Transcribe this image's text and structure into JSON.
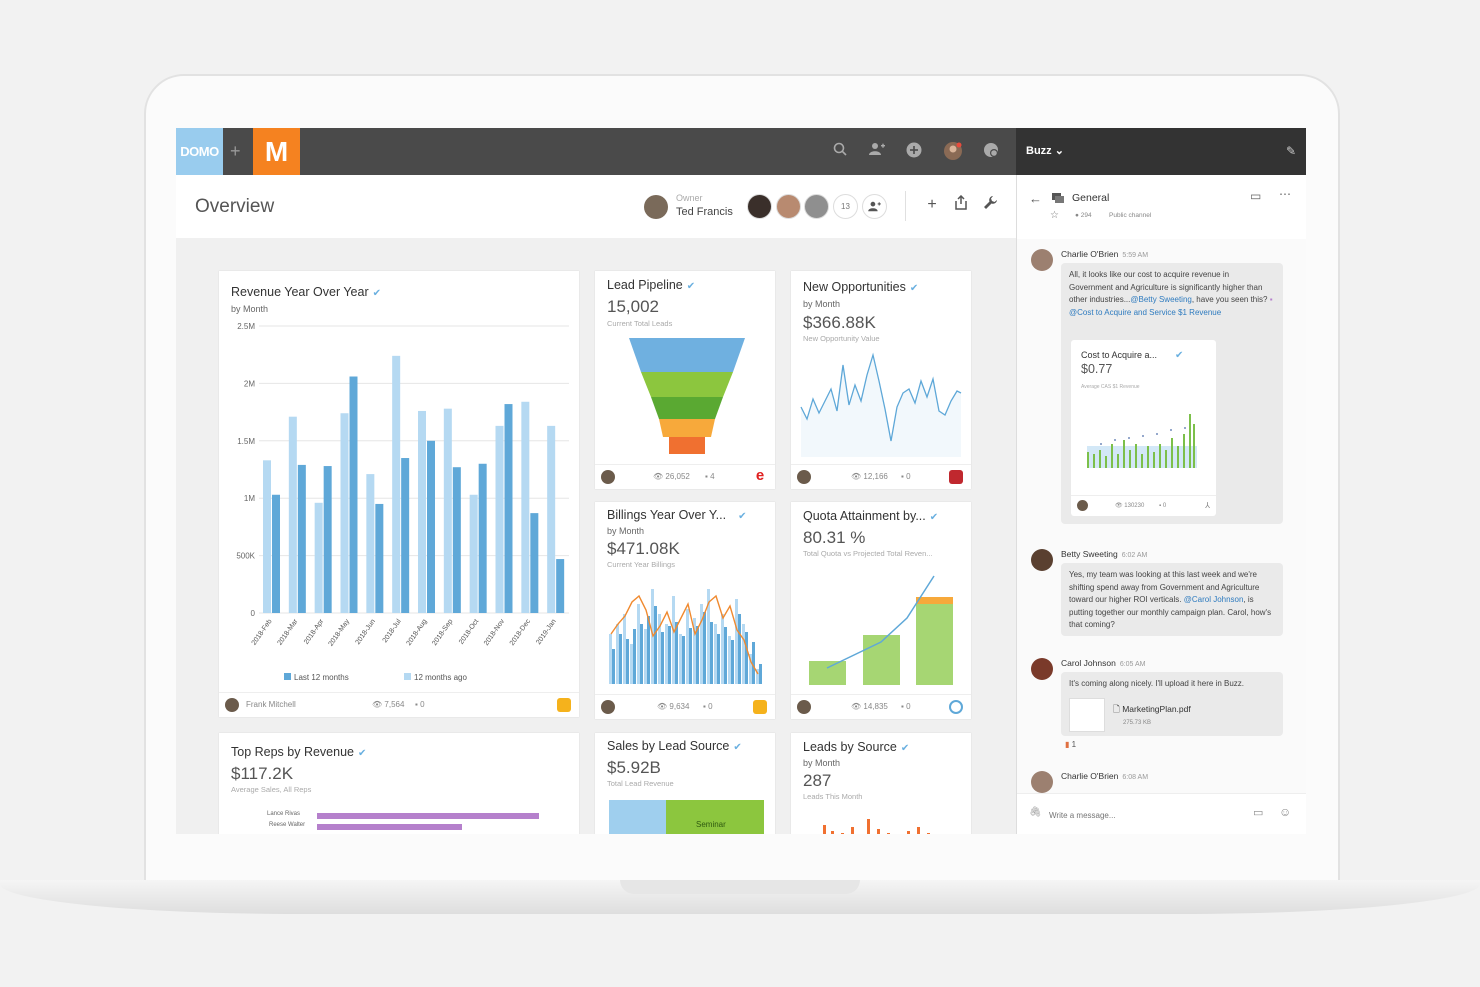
{
  "topbar": {
    "domo_logo": "DOMO",
    "plus": "+",
    "app_logo": "M",
    "icons": [
      "search-icon",
      "add-person-icon",
      "plus-circle-icon",
      "user-avatar",
      "buzz-icon"
    ]
  },
  "buzz_bar": {
    "title": "Buzz",
    "chevron": "⌄",
    "edit_icon": "✎"
  },
  "header": {
    "title": "Overview",
    "owner_label": "Owner",
    "owner_name": "Ted Francis",
    "member_count": "13"
  },
  "cards": {
    "revenue_yoy": {
      "title": "Revenue Year Over Year",
      "subtitle": "by Month",
      "legend_a": "Last 12 months",
      "legend_b": "12 months ago",
      "footer_name": "Frank Mitchell",
      "views": "7,564",
      "comments": "0"
    },
    "lead_pipeline": {
      "title": "Lead Pipeline",
      "value": "15,002",
      "caption": "Current Total Leads",
      "views": "26,052",
      "comments": "4"
    },
    "new_opps": {
      "title": "New Opportunities",
      "subtitle": "by Month",
      "value": "$366.88K",
      "caption": "New Opportunity Value",
      "views": "12,166",
      "comments": "0"
    },
    "billings": {
      "title": "Billings Year Over Y...",
      "subtitle": "by Month",
      "value": "$471.08K",
      "caption": "Current Year Billings",
      "views": "9,634",
      "comments": "0"
    },
    "quota": {
      "title": "Quota Attainment by...",
      "value": "80.31 %",
      "caption": "Total Quota vs Projected Total Reven...",
      "views": "14,835",
      "comments": "0"
    },
    "top_reps": {
      "title": "Top Reps by Revenue",
      "value": "$117.2K",
      "caption": "Average Sales, All Reps",
      "rep1": "Lance Rivas",
      "rep2": "Reese Walter"
    },
    "sales_source": {
      "title": "Sales by Lead Source",
      "value": "$5.92B",
      "caption": "Total Lead Revenue",
      "segment": "Seminar"
    },
    "leads_source": {
      "title": "Leads by Source",
      "subtitle": "by Month",
      "value": "287",
      "caption": "Leads This Month"
    }
  },
  "chart_data": [
    {
      "type": "bar",
      "title": "Revenue Year Over Year",
      "categories": [
        "2018-Feb",
        "2018-Mar",
        "2018-Apr",
        "2018-May",
        "2018-Jun",
        "2018-Jul",
        "2018-Aug",
        "2018-Sep",
        "2018-Oct",
        "2018-Nov",
        "2018-Dec",
        "2019-Jan"
      ],
      "ylim": [
        0,
        2500000
      ],
      "yticks": [
        "0",
        "500K",
        "1M",
        "1.5M",
        "2M",
        "2.5M"
      ],
      "series": [
        {
          "name": "Last 12 months",
          "values": [
            1030000,
            1290000,
            1280000,
            2060000,
            950000,
            1350000,
            1500000,
            1270000,
            1300000,
            1820000,
            870000,
            470000
          ]
        },
        {
          "name": "12 months ago",
          "values": [
            1330000,
            1710000,
            960000,
            1740000,
            1210000,
            2240000,
            1760000,
            1780000,
            1030000,
            1630000,
            1840000,
            1630000
          ]
        }
      ]
    }
  ],
  "buzz": {
    "channel_name": "General",
    "member_count": "294",
    "channel_type": "Public channel",
    "messages": [
      {
        "author": "Charlie O'Brien",
        "time": "5:59 AM",
        "text": "All, it looks like our cost to acquire revenue in Government and Agriculture is significantly higher than other industries...",
        "mention1": "@Betty Sweeting",
        "text2": ", have you seen this?",
        "mention2": "@Cost to Acquire and Service $1 Revenue"
      },
      {
        "author": "Betty Sweeting",
        "time": "6:02 AM",
        "text": "Yes, my team was looking at this last week and we're shifting spend away from Government and Agriculture toward our higher ROI verticals.",
        "mention1": "@Carol Johnson",
        "text2": ", is putting together our monthly campaign plan. Carol, how's that coming?"
      },
      {
        "author": "Carol Johnson",
        "time": "6:05 AM",
        "text": "It's coming along nicely. I'll upload it here in Buzz.",
        "file_name": "MarketingPlan.pdf",
        "file_size": "275.73 KB",
        "reaction_count": "1"
      },
      {
        "author": "Charlie O'Brien",
        "time": "6:08 AM"
      }
    ],
    "embedded_card": {
      "title": "Cost to Acquire a...",
      "value": "$0.77",
      "caption": "Average CAS $1 Revenue",
      "views": "130230",
      "comments": "0"
    },
    "composer_placeholder": "Write a message..."
  },
  "colors": {
    "topbar": "#4a4a4a",
    "domo_blue": "#99ccee",
    "m_orange": "#f58220",
    "bar_dark": "#5fa8d8",
    "bar_light": "#b5d9f2",
    "funnel": [
      "#6fb0e0",
      "#8cc63e",
      "#5aa932",
      "#f7a93b",
      "#f07030"
    ]
  }
}
